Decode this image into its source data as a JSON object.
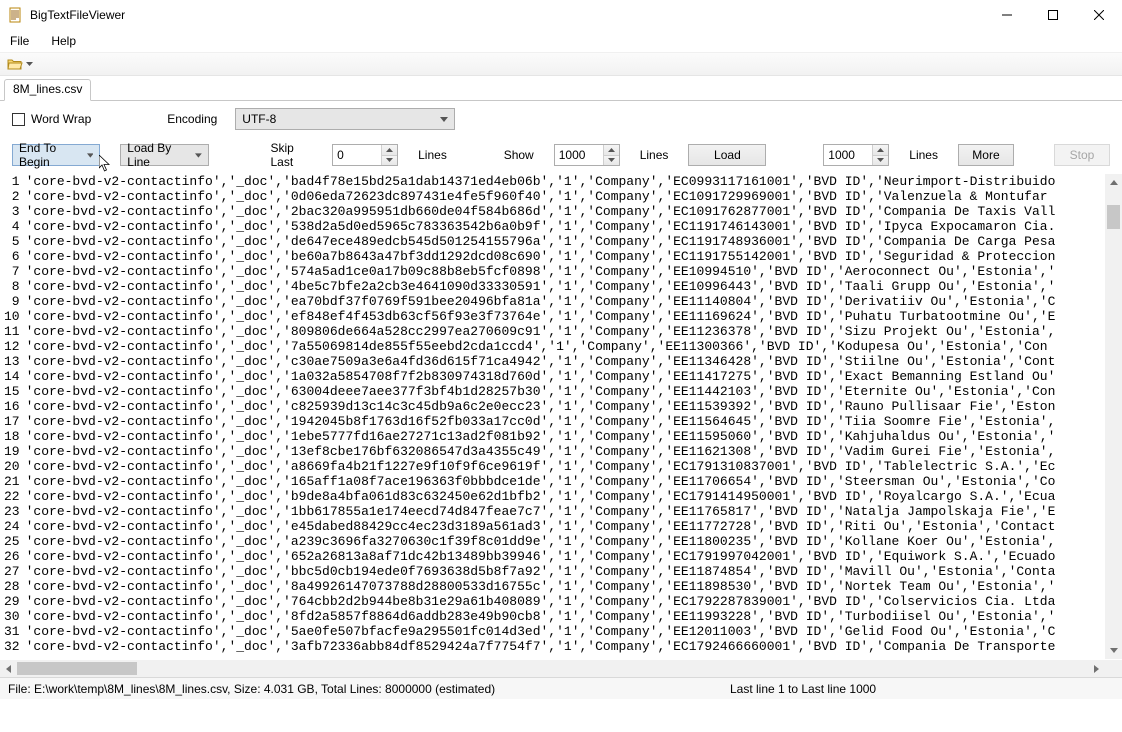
{
  "window": {
    "title": "BigTextFileViewer"
  },
  "menu": {
    "file": "File",
    "help": "Help"
  },
  "tabs": [
    {
      "label": "8M_lines.csv"
    }
  ],
  "options": {
    "wordwrap_label": "Word Wrap",
    "encoding_label": "Encoding",
    "encoding_value": "UTF-8",
    "direction_value": "End To Begin",
    "load_mode_value": "Load By Line",
    "skip_label": "Skip Last",
    "skip_value": "0",
    "skip_unit": "Lines",
    "show_label": "Show",
    "show_value": "1000",
    "show_unit": "Lines",
    "load_btn": "Load",
    "jump_value": "1000",
    "jump_unit": "Lines",
    "more_btn": "More",
    "stop_btn": "Stop"
  },
  "viewer": {
    "lines": [
      "'core-bvd-v2-contactinfo','_doc','bad4f78e15bd25a1dab14371ed4eb06b','1','Company','EC0993117161001','BVD ID','Neurimport-Distribuido",
      "'core-bvd-v2-contactinfo','_doc','0d06eda72623dc897431e4fe5f960f40','1','Company','EC1091729969001','BVD ID','Valenzuela & Montufar ",
      "'core-bvd-v2-contactinfo','_doc','2bac320a995951db660de04f584b686d','1','Company','EC1091762877001','BVD ID','Compania De Taxis Vall",
      "'core-bvd-v2-contactinfo','_doc','538d2a5d0ed5965c783363542b6a0b9f','1','Company','EC1191746143001','BVD ID','Ipyca Expocamaron Cia.",
      "'core-bvd-v2-contactinfo','_doc','de647ece489edcb545d501254155796a','1','Company','EC1191748936001','BVD ID','Compania De Carga Pesa",
      "'core-bvd-v2-contactinfo','_doc','be60a7b8643a47bf3dd1292dcd08c690','1','Company','EC1191755142001','BVD ID','Seguridad & Proteccion",
      "'core-bvd-v2-contactinfo','_doc','574a5ad1ce0a17b09c88b8eb5fcf0898','1','Company','EE10994510','BVD ID','Aeroconnect Ou','Estonia','",
      "'core-bvd-v2-contactinfo','_doc','4be5c7bfe2a2cb3e4641090d33330591','1','Company','EE10996443','BVD ID','Taali Grupp Ou','Estonia','",
      "'core-bvd-v2-contactinfo','_doc','ea70bdf37f0769f591bee20496bfa81a','1','Company','EE11140804','BVD ID','Derivatiiv Ou','Estonia','C",
      "'core-bvd-v2-contactinfo','_doc','ef848ef4f453db63cf56f93e3f73764e','1','Company','EE11169624','BVD ID','Puhatu Turbatootmine Ou','E",
      "'core-bvd-v2-contactinfo','_doc','809806de664a528cc2997ea270609c91','1','Company','EE11236378','BVD ID','Sizu Projekt Ou','Estonia',",
      "'core-bvd-v2-contactinfo','_doc','7a55069814de855f55eebd2cda1ccd4','1','Company','EE11300366','BVD ID','Kodupesa Ou','Estonia','Con",
      "'core-bvd-v2-contactinfo','_doc','c30ae7509a3e6a4fd36d615f71ca4942','1','Company','EE11346428','BVD ID','Stiilne Ou','Estonia','Cont",
      "'core-bvd-v2-contactinfo','_doc','1a032a5854708f7f2b830974318d760d','1','Company','EE11417275','BVD ID','Exact Bemanning Estland Ou'",
      "'core-bvd-v2-contactinfo','_doc','63004deee7aee377f3bf4b1d28257b30','1','Company','EE11442103','BVD ID','Eternite Ou','Estonia','Con",
      "'core-bvd-v2-contactinfo','_doc','c825939d13c14c3c45db9a6c2e0ecc23','1','Company','EE11539392','BVD ID','Rauno Pullisaar Fie','Eston",
      "'core-bvd-v2-contactinfo','_doc','1942045b8f1763d16f52fb033a17cc0d','1','Company','EE11564645','BVD ID','Tiia Soomre Fie','Estonia',",
      "'core-bvd-v2-contactinfo','_doc','1ebe5777fd16ae27271c13ad2f081b92','1','Company','EE11595060','BVD ID','Kahjuhaldus Ou','Estonia','",
      "'core-bvd-v2-contactinfo','_doc','13ef8cbe176bf632086547d3a4355c49','1','Company','EE11621308','BVD ID','Vadim Gurei Fie','Estonia',",
      "'core-bvd-v2-contactinfo','_doc','a8669fa4b21f1227e9f10f9f6ce9619f','1','Company','EC1791310837001','BVD ID','Tablelectric S.A.','Ec",
      "'core-bvd-v2-contactinfo','_doc','165aff1a08f7ace196363f0bbbdce1de','1','Company','EE11706654','BVD ID','Steersman Ou','Estonia','Co",
      "'core-bvd-v2-contactinfo','_doc','b9de8a4bfa061d83c632450e62d1bfb2','1','Company','EC1791414950001','BVD ID','Royalcargo S.A.','Ecua",
      "'core-bvd-v2-contactinfo','_doc','1bb617855a1e174eecd74d847feae7c7','1','Company','EE11765817','BVD ID','Natalja Jampolskaja Fie','E",
      "'core-bvd-v2-contactinfo','_doc','e45dabed88429cc4ec23d3189a561ad3','1','Company','EE11772728','BVD ID','Riti Ou','Estonia','Contact",
      "'core-bvd-v2-contactinfo','_doc','a239c3696fa3270630c1f39f8c01dd9e','1','Company','EE11800235','BVD ID','Kollane Koer Ou','Estonia',",
      "'core-bvd-v2-contactinfo','_doc','652a26813a8af71dc42b13489bb39946','1','Company','EC1791997042001','BVD ID','Equiwork S.A.','Ecuado",
      "'core-bvd-v2-contactinfo','_doc','bbc5d0cb194ede0f7693638d5b8f7a92','1','Company','EE11874854','BVD ID','Mavill Ou','Estonia','Conta",
      "'core-bvd-v2-contactinfo','_doc','8a49926147073788d28800533d16755c','1','Company','EE11898530','BVD ID','Nortek Team Ou','Estonia','",
      "'core-bvd-v2-contactinfo','_doc','764cbb2d2b944be8b31e29a61b408089','1','Company','EC1792287839001','BVD ID','Colservicios Cia. Ltda",
      "'core-bvd-v2-contactinfo','_doc','8fd2a5857f8864d6addb283e49b90cb8','1','Company','EE11993228','BVD ID','Turbodiisel Ou','Estonia','",
      "'core-bvd-v2-contactinfo','_doc','5ae0fe507bfacfe9a295501fc014d3ed','1','Company','EE12011003','BVD ID','Gelid Food Ou','Estonia','C",
      "'core-bvd-v2-contactinfo','_doc','3afb72336abb84df8529424a7f7754f7','1','Company','EC1792466660001','BVD ID','Compania De Transporte"
    ]
  },
  "status": {
    "left": "File: E:\\work\\temp\\8M_lines\\8M_lines.csv, Size:    4.031 GB, Total Lines: 8000000 (estimated)",
    "right": "Last line 1 to Last line 1000"
  }
}
